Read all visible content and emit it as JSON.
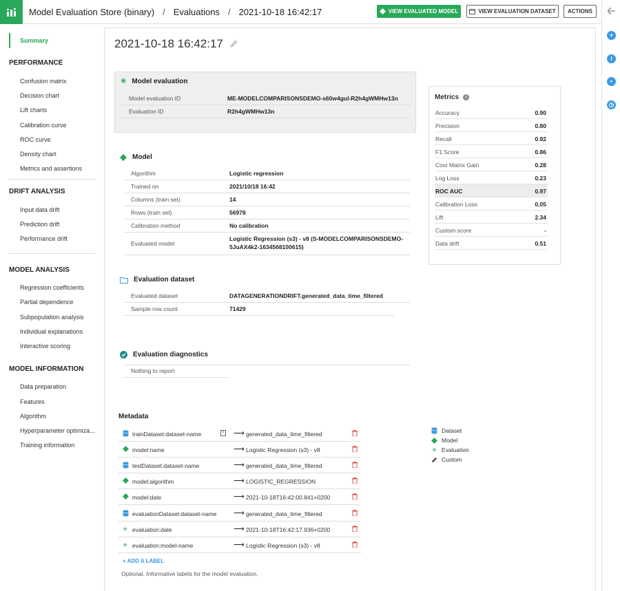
{
  "app": {
    "icon": "model-evaluation-icon",
    "accent": "#2aa85a"
  },
  "breadcrumb": {
    "store": "Model Evaluation Store (binary)",
    "sep1": "/",
    "section": "Evaluations",
    "sep2": "/",
    "current": "2021-10-18 16:42:17"
  },
  "toolbar": {
    "view_model": "VIEW EVALUATED MODEL",
    "view_dataset": "VIEW EVALUATION DATASET",
    "actions": "ACTIONS"
  },
  "sidebar": {
    "summary": "Summary",
    "performance": {
      "title": "PERFORMANCE",
      "items": [
        "Confusion matrix",
        "Decision chart",
        "Lift charts",
        "Calibration curve",
        "ROC curve",
        "Density chart",
        "Metrics and assertions"
      ]
    },
    "drift": {
      "title": "DRIFT ANALYSIS",
      "items": [
        "Input data drift",
        "Prediction drift",
        "Performance drift"
      ]
    },
    "analysis": {
      "title": "MODEL ANALYSIS",
      "items": [
        "Regression coefficients",
        "Partial dependence",
        "Subpopulation analysis",
        "Individual explanations",
        "Interactive scoring"
      ]
    },
    "info": {
      "title": "MODEL INFORMATION",
      "items": [
        "Data preparation",
        "Features",
        "Algorithm",
        "Hyperparameter optimiza...",
        "Training information"
      ]
    }
  },
  "page": {
    "title": "2021-10-18 16:42:17"
  },
  "model_evaluation": {
    "title": "Model evaluation",
    "rows": [
      {
        "k": "Model evaluation ID",
        "v": "ME-MODELCOMPARISONSDEMO-s60w4gul-R2h4gWMHw13n"
      },
      {
        "k": "Evaluation ID",
        "v": "R2h4gWMHw13n"
      }
    ]
  },
  "model": {
    "title": "Model",
    "rows": [
      {
        "k": "Algorithm",
        "v": "Logistic regression"
      },
      {
        "k": "Trained on",
        "v": "2021/10/18 16:42"
      },
      {
        "k": "Columns (train set)",
        "v": "14"
      },
      {
        "k": "Rows (train set)",
        "v": "56978"
      },
      {
        "k": "Calibration method",
        "v": "No calibration"
      }
    ],
    "evaluated_model_label": "Evaluated model",
    "evaluated_model_line1": "Logistic Regression (s3) - v8 (S-MODELCOMPARISONSDEMO-",
    "evaluated_model_line2": "5JuAX4k2-1634568100615)"
  },
  "evaluation_dataset": {
    "title": "Evaluation dataset",
    "rows": [
      {
        "k": "Evaluated dataset",
        "v": "DATAGENERATIONDRIFT.generated_data_time_filtered"
      },
      {
        "k": "Sample row count",
        "v": "71429"
      }
    ]
  },
  "diagnostics": {
    "title": "Evaluation diagnostics",
    "empty": "Nothing to report"
  },
  "metrics": {
    "title": "Metrics",
    "rows": [
      {
        "k": "Accuracy",
        "v": "0.90"
      },
      {
        "k": "Precision",
        "v": "0.80"
      },
      {
        "k": "Recall",
        "v": "0.92"
      },
      {
        "k": "F1 Score",
        "v": "0.86"
      },
      {
        "k": "Cost Matrix Gain",
        "v": "0.28"
      },
      {
        "k": "Log Loss",
        "v": "0.23"
      },
      {
        "k": "ROC AUC",
        "v": "0.97",
        "highlight": true
      },
      {
        "k": "Calibration Loss",
        "v": "0.05"
      },
      {
        "k": "Lift",
        "v": "2.34"
      },
      {
        "k": "Custom score",
        "v": "-"
      },
      {
        "k": "Data drift",
        "v": "0.51"
      }
    ]
  },
  "metadata": {
    "title": "Metadata",
    "rows": [
      {
        "type": "dataset",
        "key": "trainDataset:dataset-name",
        "warn": true,
        "value": "generated_data_time_filtered"
      },
      {
        "type": "model",
        "key": "model:name",
        "value": "Logistic Regression (s3) - v8"
      },
      {
        "type": "dataset",
        "key": "testDataset:dataset-name",
        "value": "generated_data_time_filtered"
      },
      {
        "type": "model",
        "key": "model:algorithm",
        "value": "LOGISTIC_REGRESSION"
      },
      {
        "type": "model",
        "key": "model:date",
        "value": "2021-10-18T16:42:00.841+0200"
      },
      {
        "type": "dataset",
        "key": "evaluationDataset:dataset-name",
        "value": "generated_data_time_filtered"
      },
      {
        "type": "evaluation",
        "key": "evaluation:date",
        "value": "2021-10-18T16:42:17.936+0200"
      },
      {
        "type": "evaluation",
        "key": "evaluation:model-name",
        "value": "Logistic Regression (s3) - v8"
      }
    ],
    "arrow": "⟶",
    "add_label": "+ ADD A LABEL",
    "note": "Optional. Informative labels for the model evaluation.",
    "legend": [
      {
        "type": "dataset",
        "label": "Dataset"
      },
      {
        "type": "model",
        "label": "Model"
      },
      {
        "type": "evaluation",
        "label": "Evaluation"
      },
      {
        "type": "custom",
        "label": "Custom"
      }
    ]
  },
  "colors": {
    "dataset": "#3b99e0",
    "model": "#2aa85a",
    "evaluation": "#2aa85a",
    "delete": "#d9534f",
    "link": "#3b99e0"
  }
}
